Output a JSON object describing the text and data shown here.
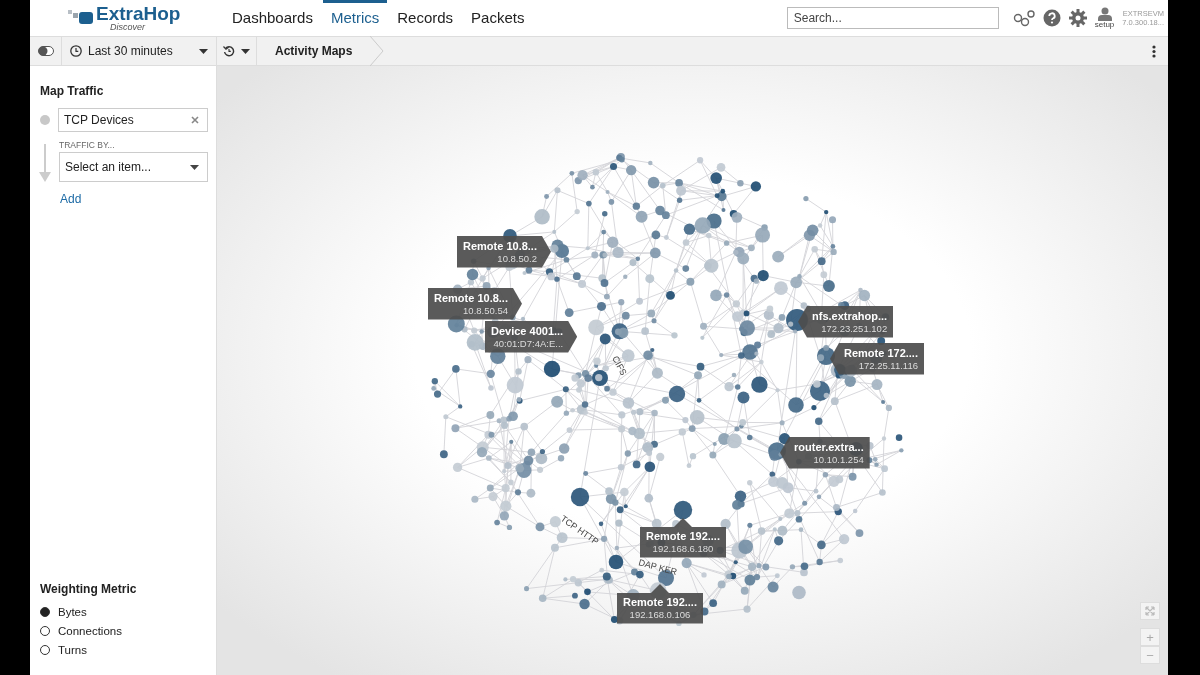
{
  "nav": {
    "logo": "ExtraHop",
    "logo_subtitle": "Discover",
    "tabs": [
      {
        "label": "Dashboards",
        "selected": false
      },
      {
        "label": "Metrics",
        "selected": true
      },
      {
        "label": "Records",
        "selected": false
      },
      {
        "label": "Packets",
        "selected": false
      }
    ],
    "search": {
      "placeholder": "Search..."
    },
    "user_label": "setup",
    "appliance": {
      "name": "EXTRSEVM",
      "version": "7.0.300.18..."
    }
  },
  "toolbar": {
    "time_range": "Last 30 minutes",
    "breadcrumb": "Activity Maps"
  },
  "sidebar": {
    "title": "Map Traffic",
    "origin": {
      "value": "TCP Devices"
    },
    "traffic_by": {
      "label": "TRAFFIC BY...",
      "placeholder": "Select an item..."
    },
    "add_link": "Add",
    "weighting": {
      "title": "Weighting Metric",
      "options": [
        {
          "label": "Bytes",
          "selected": true
        },
        {
          "label": "Connections",
          "selected": false
        },
        {
          "label": "Turns",
          "selected": false
        }
      ]
    }
  },
  "map": {
    "callouts": [
      {
        "name": "Remote 10.8...",
        "address": "10.8.50.2"
      },
      {
        "name": "Remote 10.8...",
        "address": "10.8.50.54"
      },
      {
        "name": "Device 4001...",
        "address": "40:01:D7:4A:E..."
      },
      {
        "name": "nfs.extrahop...",
        "address": "172.23.251.102"
      },
      {
        "name": "Remote 172....",
        "address": "172.25.11.116"
      },
      {
        "name": "router.extra...",
        "address": "10.10.1.254"
      },
      {
        "name": "Remote 192....",
        "address": "192.168.6.180"
      },
      {
        "name": "Remote 192....",
        "address": "192.168.0.106"
      }
    ],
    "edge_labels": [
      "CIFS",
      "TCP HTTP",
      "DAP KER"
    ],
    "zoom_controls": [
      "+",
      "−"
    ]
  }
}
